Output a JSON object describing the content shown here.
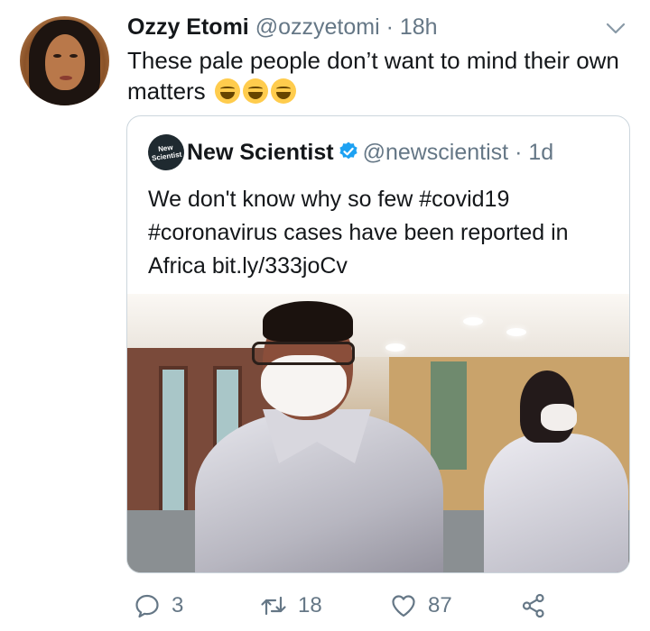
{
  "tweet": {
    "author_name": "Ozzy Etomi",
    "author_handle": "@ozzyetomi",
    "separator": "·",
    "time": "18h",
    "text": "These pale people don’t want to mind their own matters",
    "emojis": [
      "face-with-tears-of-joy-icon",
      "face-with-tears-of-joy-icon",
      "face-with-tears-of-joy-icon"
    ]
  },
  "quoted": {
    "logo_text": "New Scientist",
    "author_name": "New Scientist",
    "author_handle": "@newscientist",
    "separator": "·",
    "time": "1d",
    "text": "We don't know why so few #covid19 #coronavirus cases have been reported in Africa bit.ly/333joCv",
    "verified_icon": "verified-badge-icon"
  },
  "actions": {
    "reply_count": "3",
    "retweet_count": "18",
    "like_count": "87"
  },
  "colors": {
    "text_primary": "#14171a",
    "text_secondary": "#657786",
    "verified_blue": "#1da1f2",
    "border": "#ccd6dd"
  }
}
